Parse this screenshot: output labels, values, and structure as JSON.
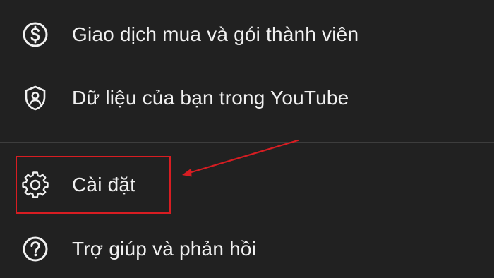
{
  "menu": {
    "items": [
      {
        "label": "Giao dịch mua và gói thành viên",
        "icon": "dollar-circle-icon"
      },
      {
        "label": "Dữ liệu của bạn trong YouTube",
        "icon": "shield-person-icon"
      },
      {
        "label": "Cài đặt",
        "icon": "gear-icon"
      },
      {
        "label": "Trợ giúp và phản hồi",
        "icon": "help-circle-icon"
      }
    ]
  },
  "annotation": {
    "highlight_color": "#d81d22",
    "highlighted_item": "Cài đặt"
  },
  "colors": {
    "background": "#212121",
    "text": "#f1f1f1",
    "divider": "#3d3d3d"
  }
}
